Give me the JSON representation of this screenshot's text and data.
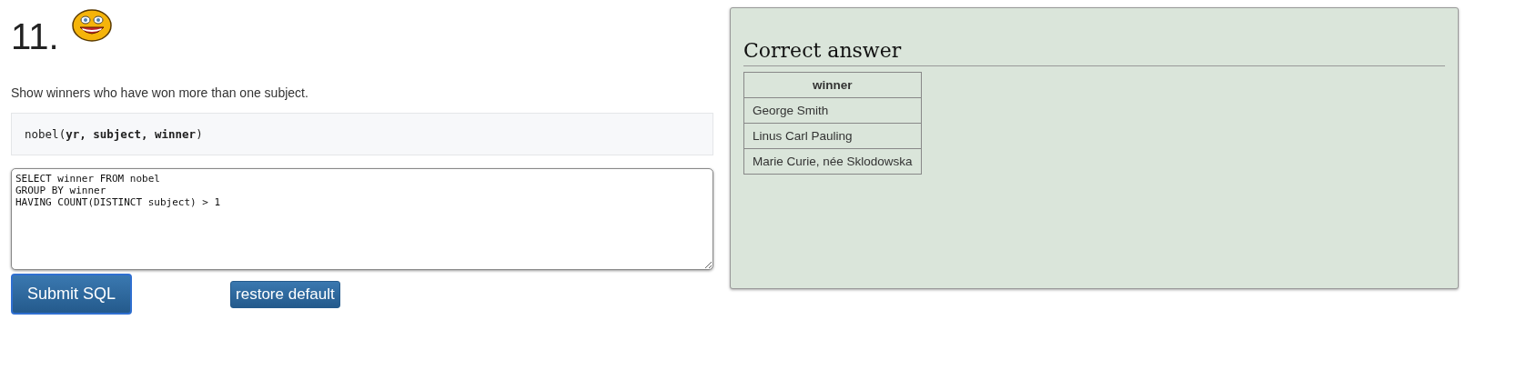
{
  "question": {
    "number": "11.",
    "text": "Show winners who have won more than one subject.",
    "schema": "nobel(**yr, subject, winner**)"
  },
  "editor": {
    "value": "SELECT winner FROM nobel\nGROUP BY winner\nHAVING COUNT(DISTINCT subject) > 1"
  },
  "buttons": [
    {
      "label": "Submit SQL",
      "kind": "primary"
    },
    {
      "label": "restore default",
      "kind": "secondary"
    }
  ],
  "answer": {
    "title": "Correct answer",
    "columns": [
      "winner"
    ],
    "rows": [
      [
        "George Smith"
      ],
      [
        "Linus Carl Pauling"
      ],
      [
        "Marie Curie, née Sklodowska"
      ]
    ]
  }
}
